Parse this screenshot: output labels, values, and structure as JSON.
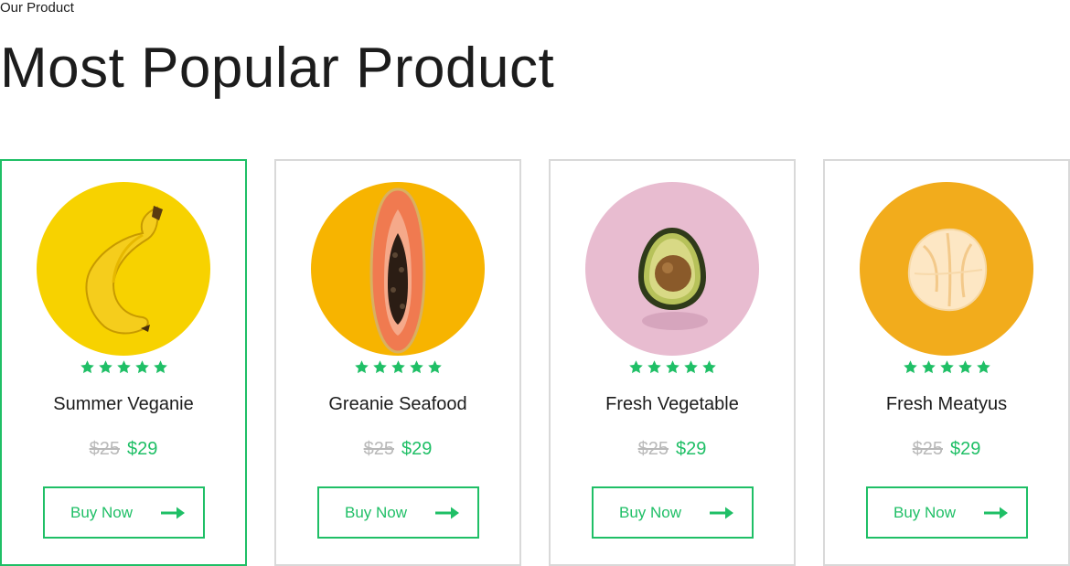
{
  "header": {
    "eyebrow": "Our Product",
    "title": "Most Popular Product"
  },
  "colors": {
    "accent": "#1fbf66",
    "border": "#d9d9d9",
    "old_price": "#b9b9b9"
  },
  "products": [
    {
      "name": "Summer Veganie",
      "old_price": "$25",
      "new_price": "$29",
      "rating": 5,
      "button_label": "Buy Now",
      "image_icon": "banana-image",
      "image_bg": "#f7d200",
      "active": true
    },
    {
      "name": "Greanie Seafood",
      "old_price": "$25",
      "new_price": "$29",
      "rating": 5,
      "button_label": "Buy Now",
      "image_icon": "papaya-image",
      "image_bg": "#f7b400",
      "active": false
    },
    {
      "name": "Fresh Vegetable",
      "old_price": "$25",
      "new_price": "$29",
      "rating": 5,
      "button_label": "Buy Now",
      "image_icon": "avocado-image",
      "image_bg": "#e8bcd0",
      "active": false
    },
    {
      "name": "Fresh Meatyus",
      "old_price": "$25",
      "new_price": "$29",
      "rating": 5,
      "button_label": "Buy Now",
      "image_icon": "orange-image",
      "image_bg": "#f2ac1c",
      "active": false
    }
  ]
}
